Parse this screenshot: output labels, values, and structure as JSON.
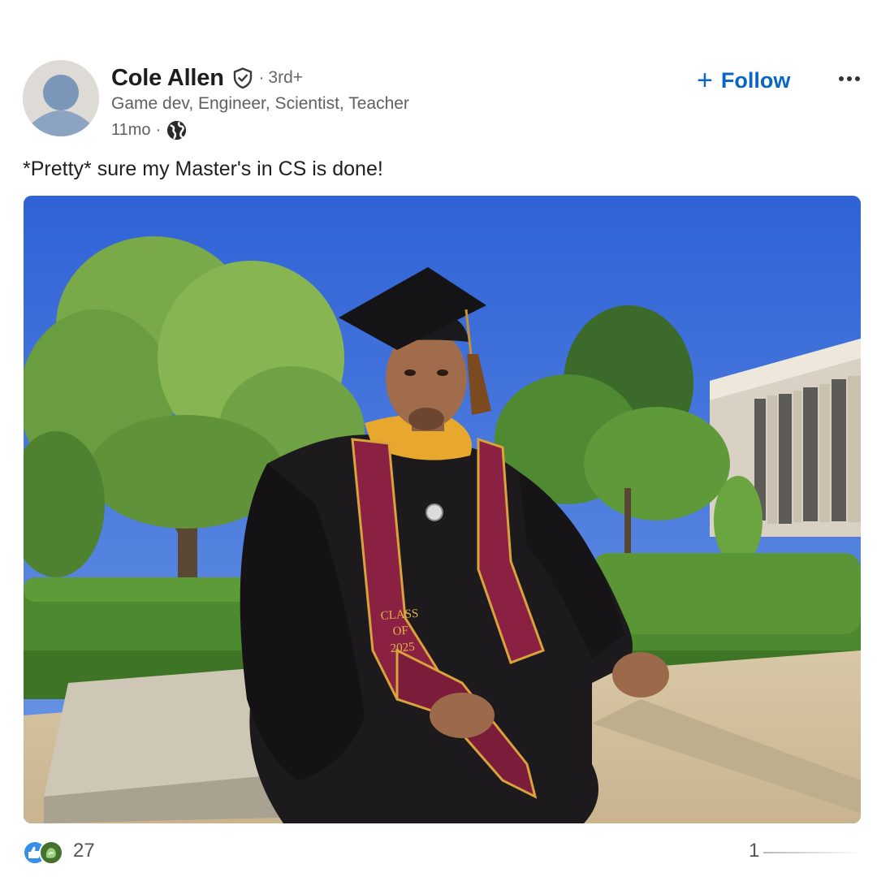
{
  "post": {
    "author": {
      "name": "Cole Allen",
      "verified_icon": "verified-shield-check-icon",
      "separator": "·",
      "degree": "3rd+",
      "headline": "Game dev, Engineer, Scientist,  Teacher",
      "time_ago": "11mo",
      "meta_separator": "·",
      "visibility_icon": "globe-icon",
      "avatar_icon": "default-person-avatar-icon"
    },
    "follow": {
      "icon": "plus-icon",
      "plus_glyph": "+",
      "label": "Follow"
    },
    "more_icon": "ellipsis-icon",
    "caption": "*Pretty* sure my Master's in CS is done!",
    "photo": {
      "alt": "Graduate in black cap and gown with maroon and gold stole sitting on a concrete bench outdoors",
      "stole_text": [
        "CLASS",
        "OF",
        "2025"
      ]
    },
    "social": {
      "reaction_icons": [
        "like-icon",
        "celebrate-icon"
      ],
      "reaction_count": "27",
      "comment_count": "1"
    },
    "colors": {
      "accent": "#0a66c2",
      "text": "#1f1f1f",
      "secondary_text": "#606060"
    }
  }
}
